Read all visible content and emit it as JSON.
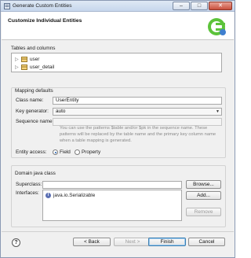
{
  "window": {
    "title": "Generate Custom Entities",
    "minimize_icon": "minimize-icon",
    "maximize_icon": "maximize-icon",
    "close_icon": "close-icon"
  },
  "header": {
    "title": "Customize Individual Entities",
    "logo_icon": "eclipse-dali-logo-icon"
  },
  "tables": {
    "label": "Tables and columns",
    "items": [
      {
        "label": "user",
        "icon": "table-icon"
      },
      {
        "label": "user_detail",
        "icon": "table-icon"
      }
    ]
  },
  "mapping": {
    "group_label": "Mapping defaults",
    "class_name_label": "Class name:",
    "class_name_value": "UserEntity",
    "key_generator_label": "Key generator:",
    "key_generator_value": "auto",
    "sequence_name_label": "Sequence name:",
    "sequence_name_value": "",
    "help_text": "You can use the patterns $table and/or $pk in the sequence name. These patterns will be replaced by the table name and the primary key column name when a table mapping is generated.",
    "entity_access_label": "Entity access:",
    "access_options": [
      "Field",
      "Property"
    ],
    "access_selected": "Field"
  },
  "domain": {
    "group_label": "Domain java class",
    "superclass_label": "Superclass:",
    "superclass_value": "",
    "browse_label": "Browse...",
    "interfaces_label": "Interfaces:",
    "interfaces": [
      "java.io.Serializable"
    ],
    "add_label": "Add...",
    "remove_label": "Remove"
  },
  "footer": {
    "help_icon": "help-icon",
    "back_label": "< Back",
    "next_label": "Next >",
    "finish_label": "Finish",
    "cancel_label": "Cancel"
  }
}
